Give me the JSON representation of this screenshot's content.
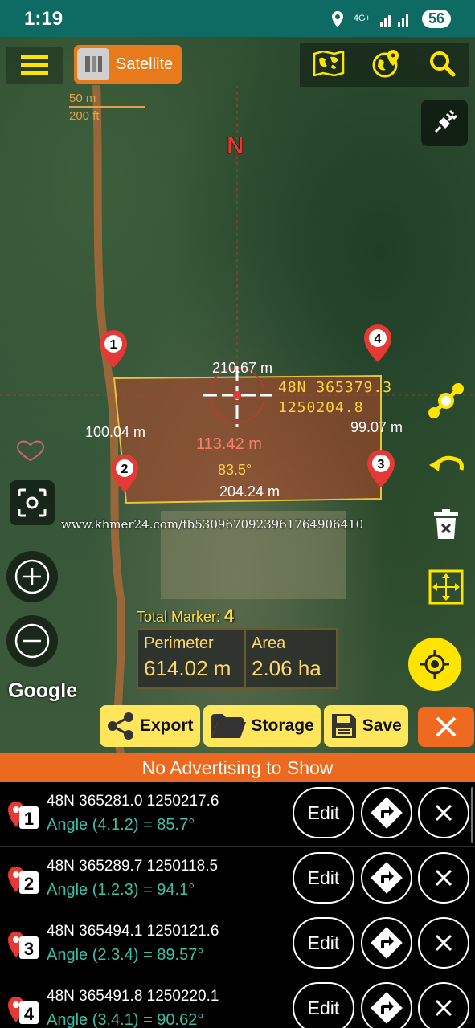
{
  "status_bar": {
    "time": "1:19",
    "network": "4G+",
    "battery": "56"
  },
  "toolbar": {
    "map_type_label": "Satellite"
  },
  "scale": {
    "metric": "50 m",
    "imperial": "200 ft"
  },
  "map": {
    "north_label": "N",
    "edges": {
      "top": "210.67 m",
      "left": "100.04 m",
      "right": "99.07 m",
      "bottom": "204.24 m"
    },
    "diagonal": "113.42 m",
    "angle": "83.5°",
    "center_coords": {
      "zone_easting": "48N  365379.3",
      "northing": "1250204.8"
    },
    "markers": [
      "1",
      "2",
      "3",
      "4"
    ],
    "watermark": "www.khmer24.com/fb5309670923961764906410",
    "attribution": "Google"
  },
  "summary": {
    "total_marker_label": "Total Marker:",
    "total_marker_count": "4",
    "perimeter_label": "Perimeter",
    "perimeter_value": "614.02 m",
    "area_label": "Area",
    "area_value": "2.06 ha"
  },
  "actions": {
    "export": "Export",
    "storage": "Storage",
    "save": "Save"
  },
  "ad_text": "No Advertising to Show",
  "points": [
    {
      "num": "1",
      "coords": "48N  365281.0  1250217.6",
      "angle": "Angle (4.1.2) = 85.7°",
      "edit": "Edit"
    },
    {
      "num": "2",
      "coords": "48N  365289.7  1250118.5",
      "angle": "Angle (1.2.3) = 94.1°",
      "edit": "Edit"
    },
    {
      "num": "3",
      "coords": "48N  365494.1  1250121.6",
      "angle": "Angle (2.3.4) = 89.57°",
      "edit": "Edit"
    },
    {
      "num": "4",
      "coords": "48N  365491.8  1250220.1",
      "angle": "Angle (3.4.1) = 90.62°",
      "edit": "Edit"
    }
  ],
  "colors": {
    "accent": "#ec6a20",
    "status_bar": "#0e6b63",
    "highlight": "#ffe400",
    "angle_text": "#3cc0a8"
  }
}
